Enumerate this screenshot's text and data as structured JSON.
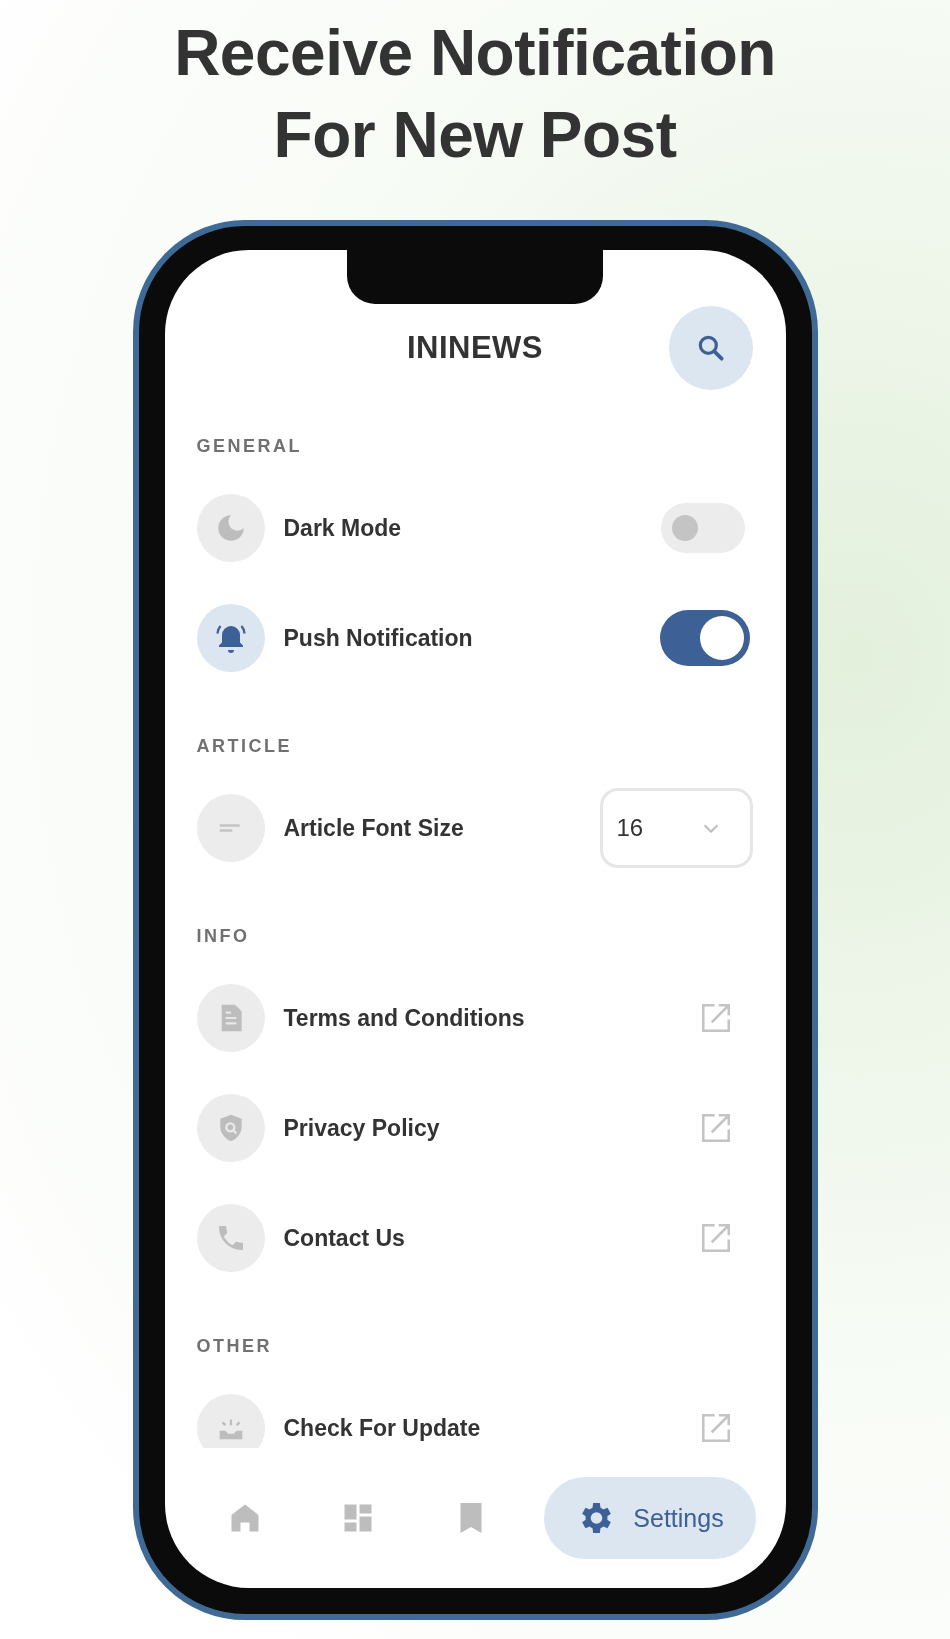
{
  "headline": [
    "Receive Notification",
    "For New Post"
  ],
  "app_title": "ININEWS",
  "sections": [
    {
      "title": "GENERAL",
      "items": [
        {
          "kind": "toggle",
          "label": "Dark Mode",
          "on": false
        },
        {
          "kind": "toggle",
          "label": "Push Notification",
          "on": true
        }
      ]
    },
    {
      "title": "ARTICLE",
      "items": [
        {
          "kind": "select",
          "label": "Article Font Size",
          "value": "16"
        }
      ]
    },
    {
      "title": "INFO",
      "items": [
        {
          "kind": "link",
          "label": "Terms and Conditions"
        },
        {
          "kind": "link",
          "label": "Privacy Policy"
        },
        {
          "kind": "link",
          "label": "Contact Us"
        }
      ]
    },
    {
      "title": "OTHER",
      "items": [
        {
          "kind": "link",
          "label": "Check For Update"
        }
      ]
    }
  ],
  "nav": [
    {
      "kind": "home",
      "selected": false
    },
    {
      "kind": "dashboard",
      "selected": false
    },
    {
      "kind": "bookmark",
      "selected": false
    },
    {
      "kind": "settings",
      "label": "Settings",
      "selected": true
    }
  ]
}
